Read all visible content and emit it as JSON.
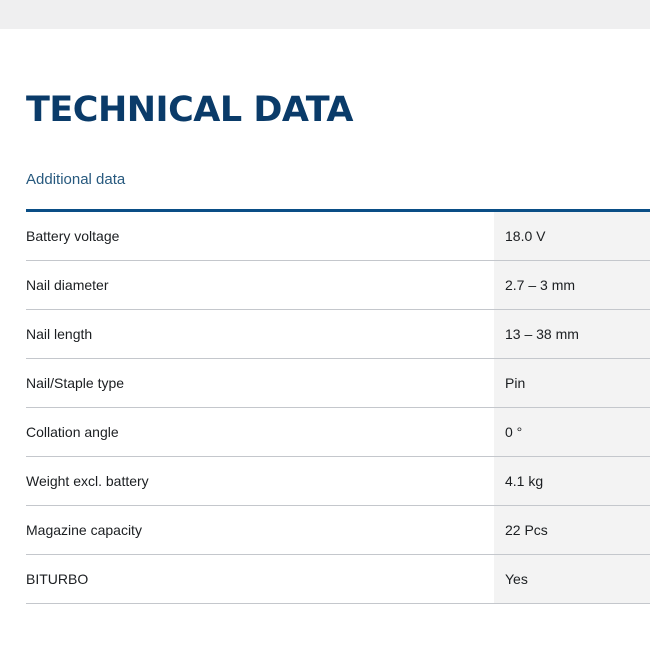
{
  "page": {
    "title": "TECHNICAL DATA",
    "section_link": "Additional data"
  },
  "colors": {
    "title": "#0a3b69",
    "accent_rule": "#0a4e86",
    "link": "#27597e",
    "value_cell_bg": "#f3f3f3",
    "top_bar_bg": "#efeff0"
  },
  "specs": [
    {
      "label": "Battery voltage",
      "value": "18.0 V"
    },
    {
      "label": "Nail diameter",
      "value": "2.7 – 3 mm"
    },
    {
      "label": "Nail length",
      "value": "13 – 38 mm"
    },
    {
      "label": "Nail/Staple type",
      "value": "Pin"
    },
    {
      "label": "Collation angle",
      "value": "0 °"
    },
    {
      "label": "Weight excl. battery",
      "value": "4.1 kg"
    },
    {
      "label": "Magazine capacity",
      "value": "22 Pcs"
    },
    {
      "label": "BITURBO",
      "value": "Yes"
    }
  ]
}
